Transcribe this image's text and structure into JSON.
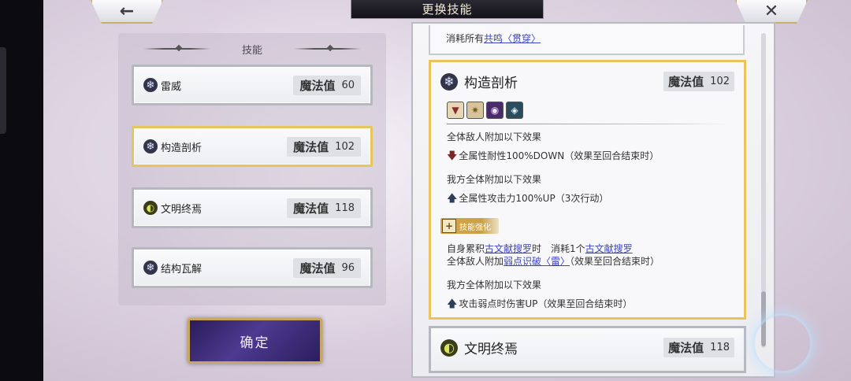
{
  "header": {
    "title": "更换技能",
    "back_icon": "←",
    "close_icon": "✕"
  },
  "left_panel": {
    "title": "技能",
    "skills": [
      {
        "name": "雷威",
        "mp_label": "魔法值",
        "mp": "60",
        "icon": "snowflake-icon"
      },
      {
        "name": "构造剖析",
        "mp_label": "魔法值",
        "mp": "102",
        "icon": "snowflake-icon",
        "selected": true
      },
      {
        "name": "文明终焉",
        "mp_label": "魔法值",
        "mp": "118",
        "icon": "civilization-icon"
      },
      {
        "name": "结构瓦解",
        "mp_label": "魔法值",
        "mp": "96",
        "icon": "snowflake-icon"
      }
    ],
    "confirm_label": "确定"
  },
  "detail": {
    "prev_card": {
      "text_prefix": "消耗所有",
      "link": "共鸣〈贯穿〉"
    },
    "title": "构造剖析",
    "mp_label": "魔法值",
    "mp": "102",
    "effects": {
      "e1_head": "全体敌人附加以下效果",
      "e1_line": "全属性耐性100%DOWN（效果至回合结束时）",
      "e2_head": "我方全体附加以下效果",
      "e2_line": "全属性攻击力100%UP（3次行动）",
      "enhance_tag": "技能强化",
      "e3_p1": "自身累积",
      "e3_link1": "古文献搜罗",
      "e3_p2": "时　消耗1个",
      "e3_link2": "古文献搜罗",
      "e3_p3": "全体敌人附加",
      "e3_link3": "弱点识破〈雷〉",
      "e3_p4": "（效果至回合结束时）",
      "e4_head": "我方全体附加以下效果",
      "e4_line": "攻击弱点时伤害UP（效果至回合结束时）"
    },
    "next_card": {
      "title": "文明终焉",
      "mp_label": "魔法值",
      "mp": "118"
    }
  },
  "colors": {
    "selected_border": "#e9c45d",
    "link": "#3b44c4",
    "confirm_bg": "#3a2a78"
  }
}
